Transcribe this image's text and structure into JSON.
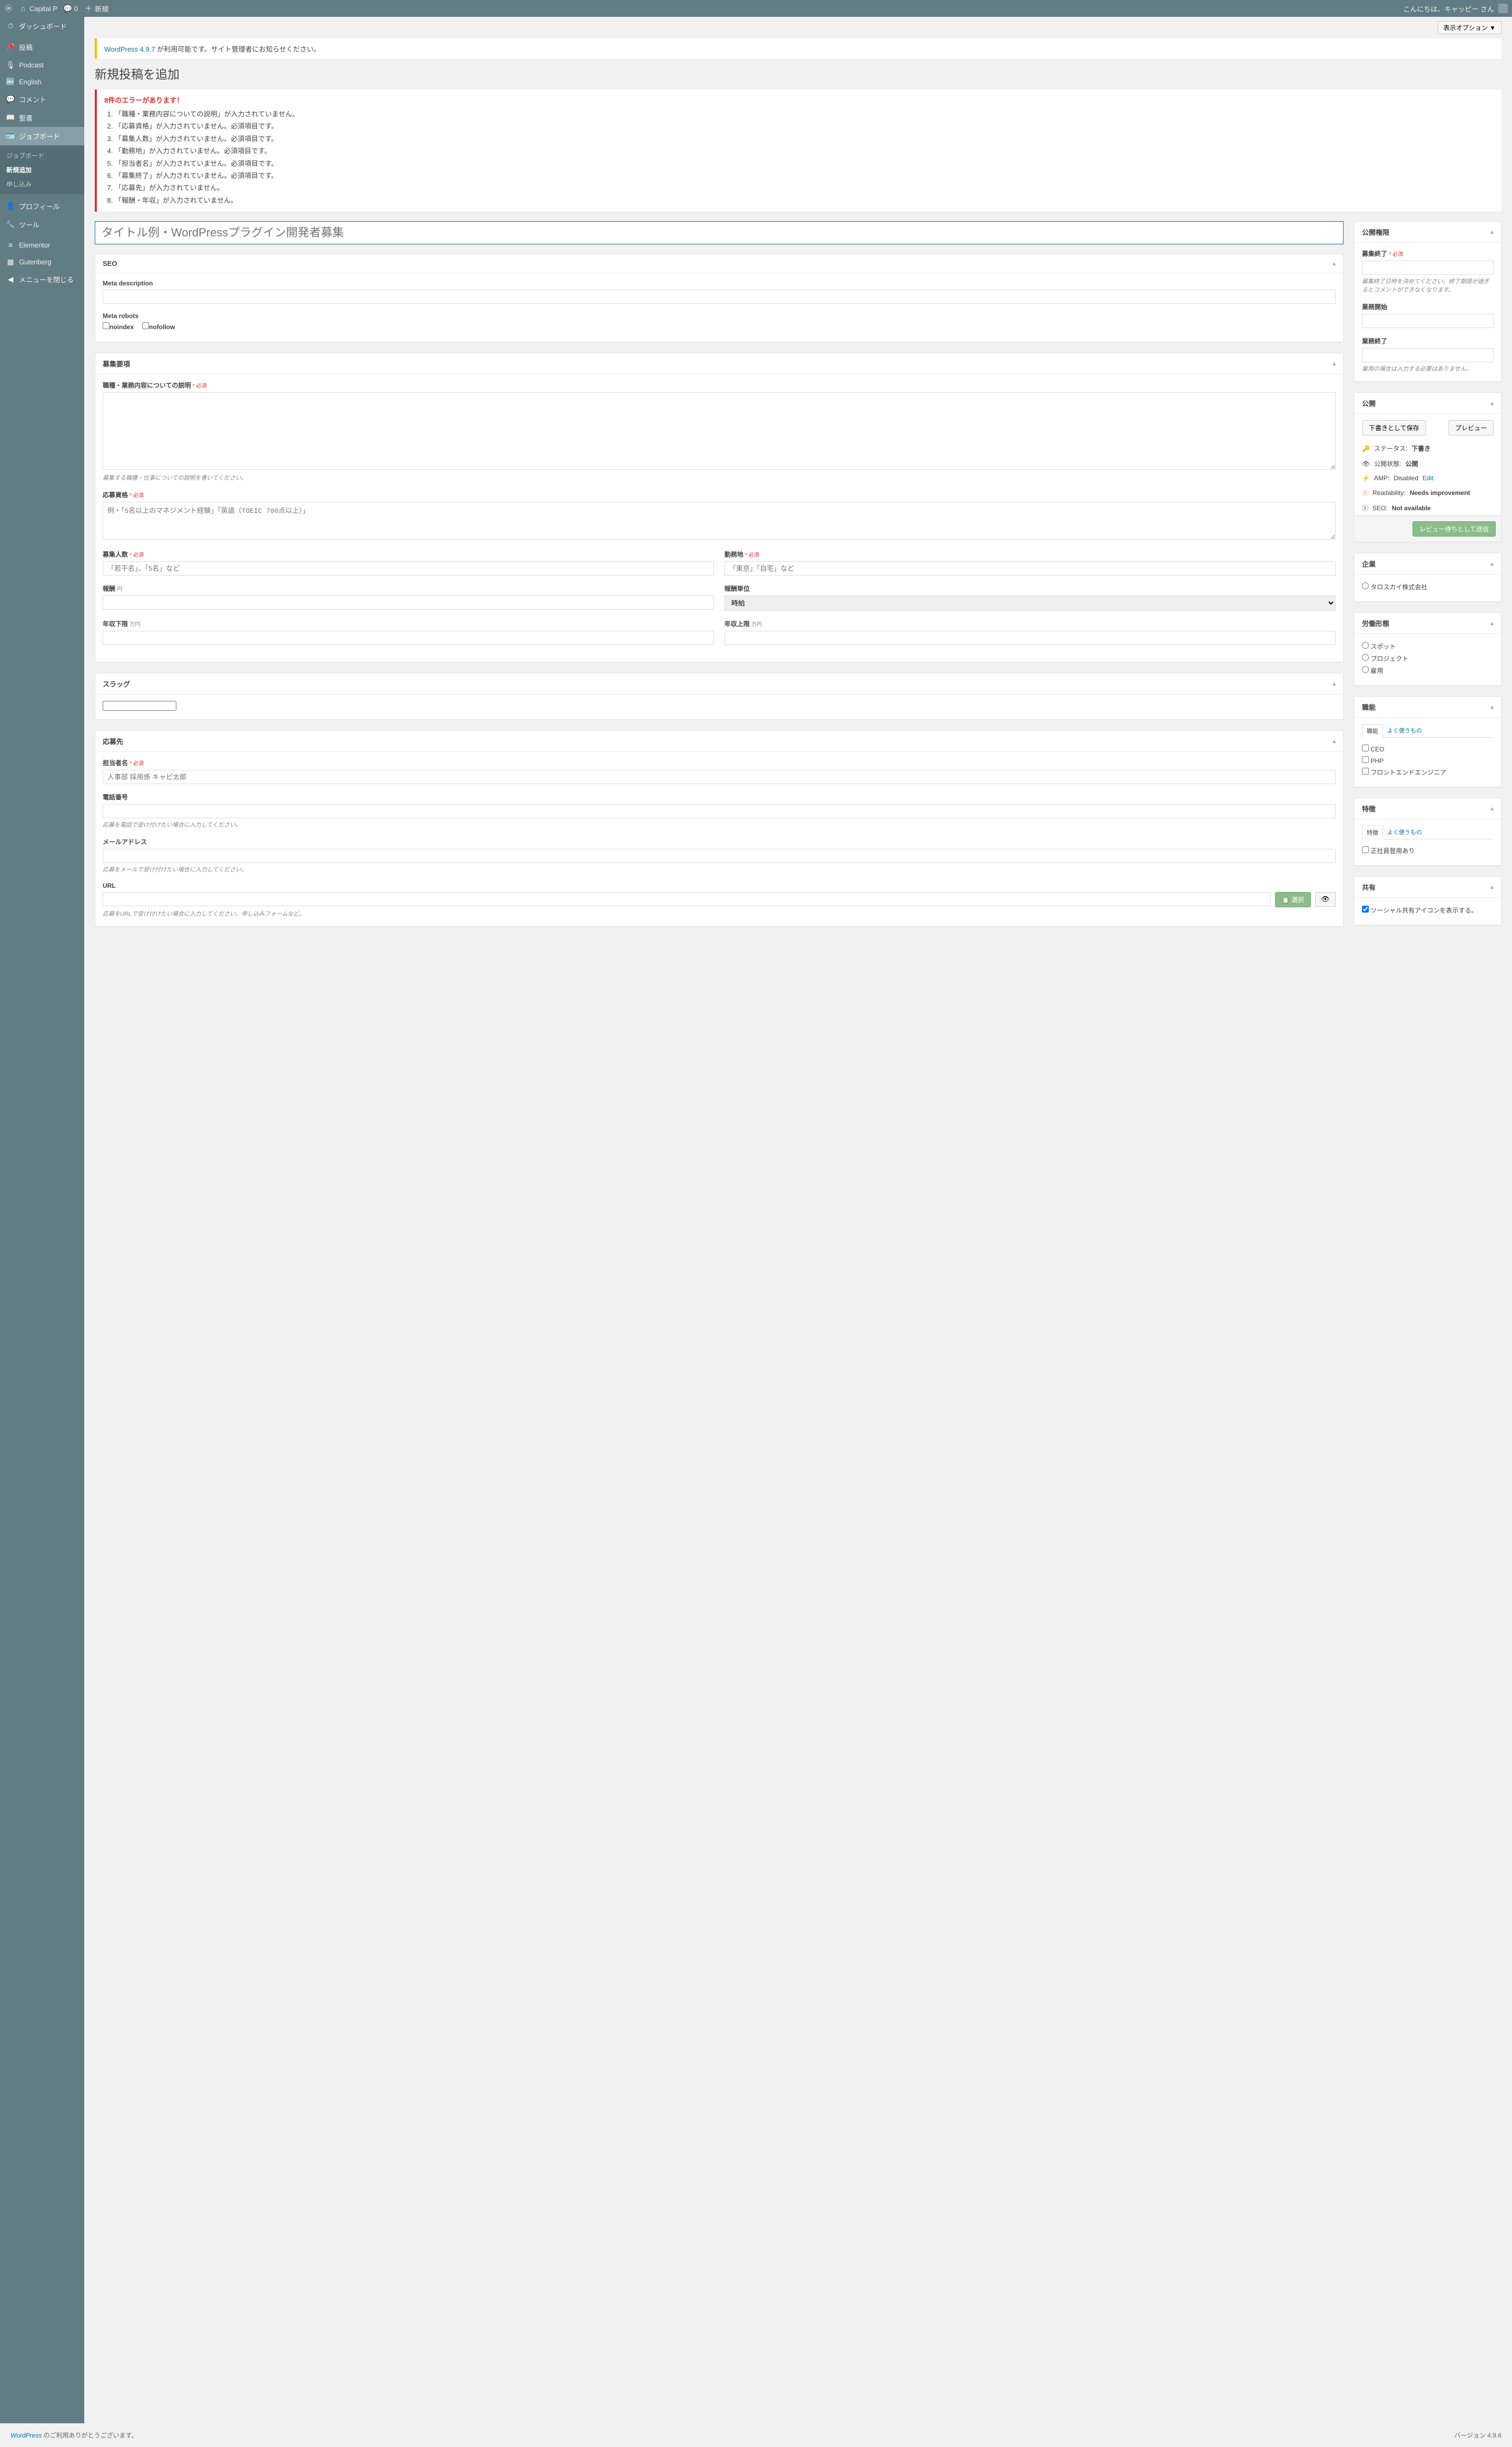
{
  "adminbar": {
    "site": "Capital P",
    "comments": "0",
    "new": "新規",
    "greeting": "こんにちは、キャッピー さん"
  },
  "sidebar": {
    "dashboard": "ダッシュボード",
    "posts": "投稿",
    "podcast": "Podcast",
    "english": "English",
    "comments": "コメント",
    "bible": "聖書",
    "jobboard": "ジョブボード",
    "sub_jobboard": "ジョブボード",
    "sub_new": "新規追加",
    "sub_apply": "申し込み",
    "profile": "プロフィール",
    "tools": "ツール",
    "elementor": "Elementor",
    "gutenberg": "Gutenberg",
    "collapse": "メニューを閉じる"
  },
  "screen_options": "表示オプション ▼",
  "update_notice": {
    "link": "WordPress 4.9.7",
    "text": " が利用可能です。サイト管理者にお知らせください。"
  },
  "page_title": "新規投稿を追加",
  "errors": {
    "heading": "8件のエラーがあります！",
    "list": [
      "「職種・業務内容についての説明」が入力されていません。",
      "「応募資格」が入力されていません。必須項目です。",
      "「募集人数」が入力されていません。必須項目です。",
      "「勤務地」が入力されていません。必須項目です。",
      "「担当者名」が入力されていません。必須項目です。",
      "「募集終了」が入力されていません。必須項目です。",
      "「応募先」が入力されていません。",
      "「報酬・年収」が入力されていません。"
    ]
  },
  "title_placeholder": "タイトル例・WordPressプラグイン開発者募集",
  "seo": {
    "heading": "SEO",
    "meta_desc_label": "Meta description",
    "meta_robots_label": "Meta robots",
    "noindex": "noindex",
    "nofollow": "nofollow"
  },
  "recruit": {
    "heading": "募集要項",
    "job_desc_label": "職種・業務内容についての説明",
    "job_desc_help": "募集する職種・仕事についての説明を書いてください。",
    "qual_label": "応募資格",
    "qual_placeholder": "例・「5名以上のマネジメント経験」「英語（TOEIC 700点以上）」",
    "count_label": "募集人数",
    "count_placeholder": "「若干名」、「5名」など",
    "location_label": "勤務地",
    "location_placeholder": "「東京」「自宅」など",
    "reward_label": "報酬",
    "reward_unit": "円",
    "reward_type_label": "報酬単位",
    "reward_type_value": "時給",
    "salary_min_label": "年収下限",
    "salary_max_label": "年収上限",
    "salary_unit": "万円",
    "required": "* 必須"
  },
  "slug": {
    "heading": "スラッグ"
  },
  "apply": {
    "heading": "応募先",
    "person_label": "担当者名",
    "person_placeholder": "人事部 採用係 キャピ太郎",
    "tel_label": "電話番号",
    "tel_help": "応募を電話で受け付けたい場合に入力してください。",
    "email_label": "メールアドレス",
    "email_help": "応募をメールで受け付けたい場合に入力してください。",
    "url_label": "URL",
    "url_help": "応募をURLで受け付けたい場合に入力してください。申し込みフォームなど。",
    "select_btn": "選択"
  },
  "side": {
    "perm": {
      "heading": "公開権限",
      "end_label": "募集終了",
      "end_help": "募集終了日時を決めてください。終了期限が過ぎるとコメントができなくなります。",
      "start_label": "業務開始",
      "finish_label": "業務終了",
      "finish_help": "雇用の場合は入力する必要はありません。"
    },
    "publish": {
      "heading": "公開",
      "save_draft": "下書きとして保存",
      "preview": "プレビュー",
      "status_label": "ステータス:",
      "status_value": "下書き",
      "visibility_label": "公開状態:",
      "visibility_value": "公開",
      "amp_label": "AMP:",
      "amp_value": "Disabled",
      "amp_edit": "Edit",
      "readability_label": "Readability:",
      "readability_value": "Needs improvement",
      "seo_label": "SEO:",
      "seo_value": "Not available",
      "submit": "レビュー待ちとして送信"
    },
    "company": {
      "heading": "企業",
      "option": "タロスカイ株式会社"
    },
    "worktype": {
      "heading": "労働形態",
      "options": [
        "スポット",
        "プロジェクト",
        "雇用"
      ]
    },
    "role": {
      "heading": "職能",
      "tab1": "職能",
      "tab2": "よく使うもの",
      "options": [
        "CEO",
        "PHP",
        "フロントエンドエンジニア"
      ]
    },
    "feature": {
      "heading": "特徴",
      "tab1": "特徴",
      "tab2": "よく使うもの",
      "option": "正社員登用あり"
    },
    "share": {
      "heading": "共有",
      "option": "ソーシャル共有アイコンを表示する。"
    }
  },
  "footer": {
    "thanks_link": "WordPress",
    "thanks_text": " のご利用ありがとうございます。",
    "version": "バージョン 4.9.6"
  }
}
